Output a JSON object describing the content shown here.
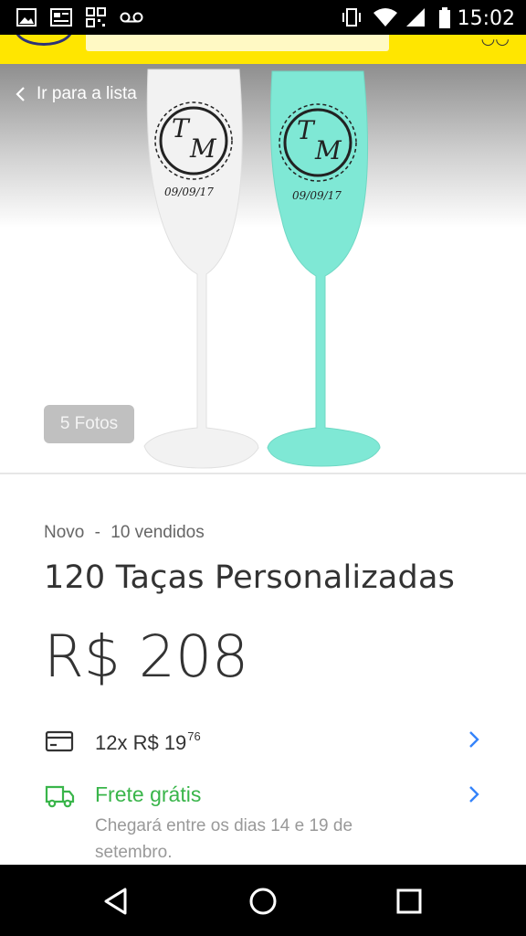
{
  "status_bar": {
    "time": "15:02",
    "left_icons": [
      "image-icon",
      "news-icon",
      "qr-icon",
      "voicemail-icon"
    ],
    "right_icons": [
      "vibrate-icon",
      "wifi-icon",
      "signal-icon",
      "battery-icon"
    ]
  },
  "image_area": {
    "back_label": "Ir para a lista",
    "photo_count": "5 Fotos",
    "glass_monogram_top": "T",
    "glass_monogram_bottom": "M",
    "glass_date": "09/09/17"
  },
  "product": {
    "condition": "Novo",
    "separator": "-",
    "sold": "10 vendidos",
    "title": "120 Taças Personalizadas",
    "price": "R$ 208"
  },
  "installments": {
    "text": "12x R$ 19",
    "cents": "76"
  },
  "shipping": {
    "label": "Frete grátis",
    "detail": "Chegará entre os dias 14 e 19 de setembro."
  },
  "colors": {
    "header_yellow": "#ffe600",
    "shipping_green": "#39b54a",
    "chevron_blue": "#3483fa",
    "glass_mint": "#7fe8d5"
  },
  "nav_bar": {
    "buttons": [
      "back-icon",
      "home-icon",
      "recents-icon"
    ]
  }
}
